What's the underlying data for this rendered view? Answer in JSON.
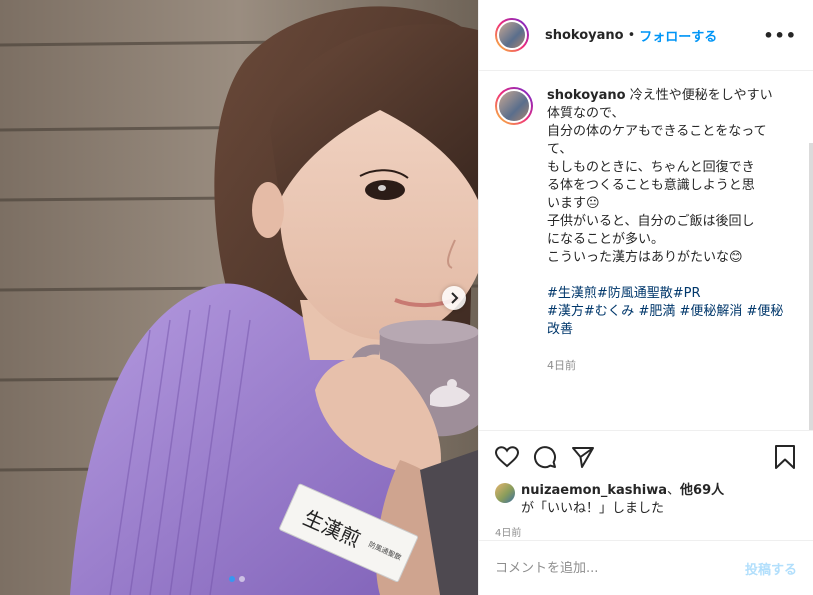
{
  "header": {
    "username": "shokoyano",
    "separator": "•",
    "follow_label": "フォローする",
    "more_label": "•••"
  },
  "caption": {
    "username": "shokoyano",
    "lines": [
      "冷え性や便秘をしやすい",
      "体質なので、",
      "自分の体のケアもできることをなって",
      "て、",
      "もしものときに、ちゃんと回復でき",
      "る体をつくることも意識しようと思",
      "います😐",
      "子供がいると、自分のご飯は後回し",
      "になることが多い。",
      "こういった漢方はありがたいな😊"
    ],
    "hashtag_lines": [
      "#生漢煎#防風通聖散#PR",
      "#漢方#むくみ #肥満 #便秘解消 #便秘",
      "改善"
    ],
    "time": "4日前"
  },
  "likes": {
    "liker": "nuizaemon_kashiwa",
    "joiner": "、",
    "others": "他69人",
    "suffix": "が「いいね！」しました"
  },
  "date": "4日前",
  "comment_box": {
    "placeholder": "コメントを追加...",
    "post_label": "投稿する"
  },
  "media": {
    "sachet_text": "生漢煎",
    "sachet_subtext": "防風通聖散",
    "carousel_count": 2,
    "carousel_active": 1
  },
  "colors": {
    "accent": "#0095f6",
    "hashtag": "#00376b",
    "muted": "#8e8e8e",
    "post_disabled": "#b2dffc",
    "sweater": "#9b7fc8"
  },
  "icons": {
    "like": "heart-icon",
    "comment": "comment-icon",
    "share": "paper-plane-icon",
    "save": "bookmark-icon",
    "next": "chevron-right-icon"
  }
}
